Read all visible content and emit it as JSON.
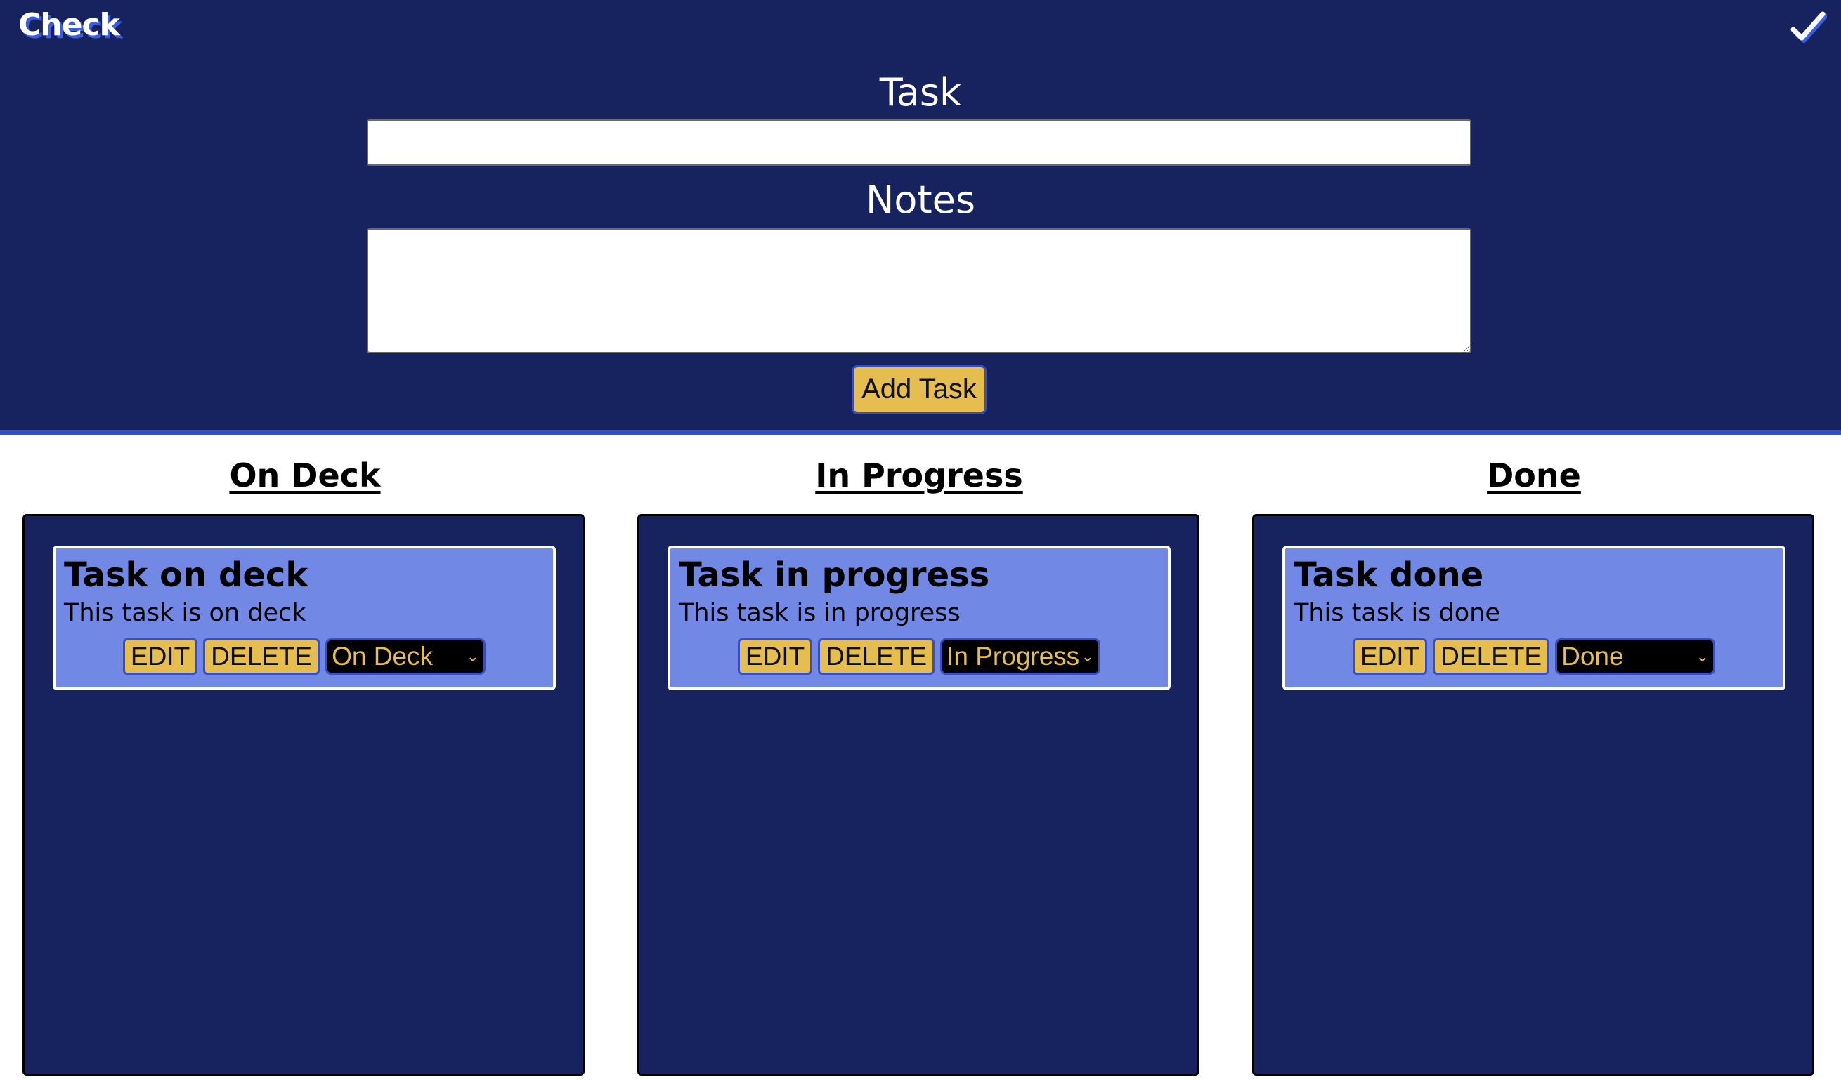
{
  "app": {
    "brand": "Check"
  },
  "form": {
    "task_label": "Task",
    "task_value": "",
    "notes_label": "Notes",
    "notes_value": "",
    "add_button": "Add Task"
  },
  "columns": [
    {
      "title": "On Deck",
      "tasks": [
        {
          "title": "Task on deck",
          "notes": "This task is on deck",
          "edit": "EDIT",
          "delete": "DELETE",
          "status": "On Deck"
        }
      ]
    },
    {
      "title": "In Progress",
      "tasks": [
        {
          "title": "Task in progress",
          "notes": "This task is in progress",
          "edit": "EDIT",
          "delete": "DELETE",
          "status": "In Progress"
        }
      ]
    },
    {
      "title": "Done",
      "tasks": [
        {
          "title": "Task done",
          "notes": "This task is done",
          "edit": "EDIT",
          "delete": "DELETE",
          "status": "Done"
        }
      ]
    }
  ],
  "icons": {
    "header_right": "checkmark-icon",
    "select_arrow": "chevron-down-icon"
  },
  "colors": {
    "header_bg": "#17235f",
    "accent_border": "#2f52c9",
    "card_bg": "#7188e4",
    "button_bg": "#e6bd4f",
    "select_bg": "#000000"
  }
}
